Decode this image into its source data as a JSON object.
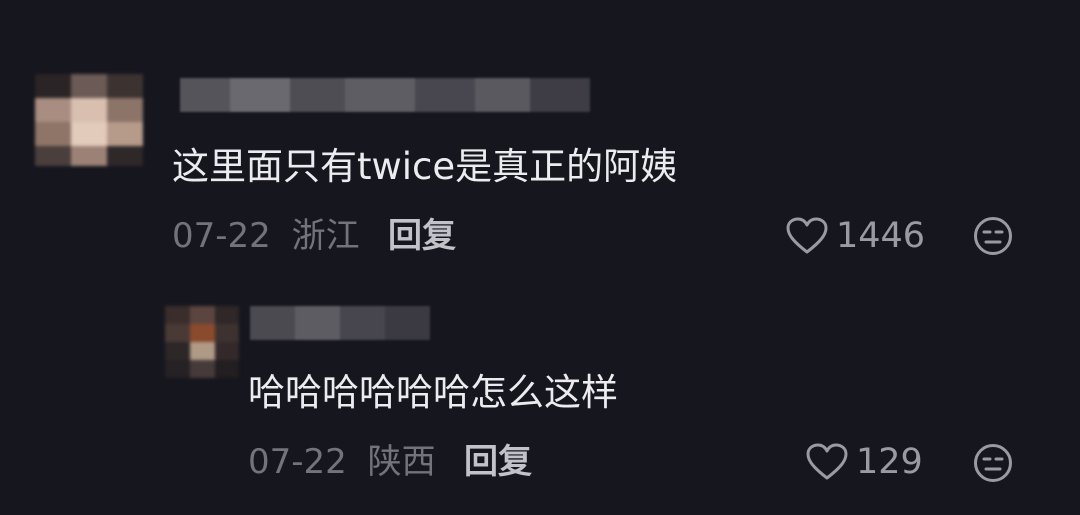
{
  "comments": [
    {
      "content": "这里面只有twice是真正的阿姨",
      "date": "07-22",
      "location": "浙江",
      "reply_label": "回复",
      "likes": "1446",
      "like_icon": "heart-outline-icon",
      "reaction_icon": "emoji-face-icon"
    },
    {
      "content": "哈哈哈哈哈哈怎么这样",
      "date": "07-22",
      "location": "陕西",
      "reply_label": "回复",
      "likes": "129",
      "like_icon": "heart-outline-icon",
      "reaction_icon": "emoji-face-icon"
    }
  ],
  "colors": {
    "background": "#16161e",
    "content_text": "#ecebef",
    "meta_text": "#74737b",
    "reply_text": "#c3c2c9"
  }
}
